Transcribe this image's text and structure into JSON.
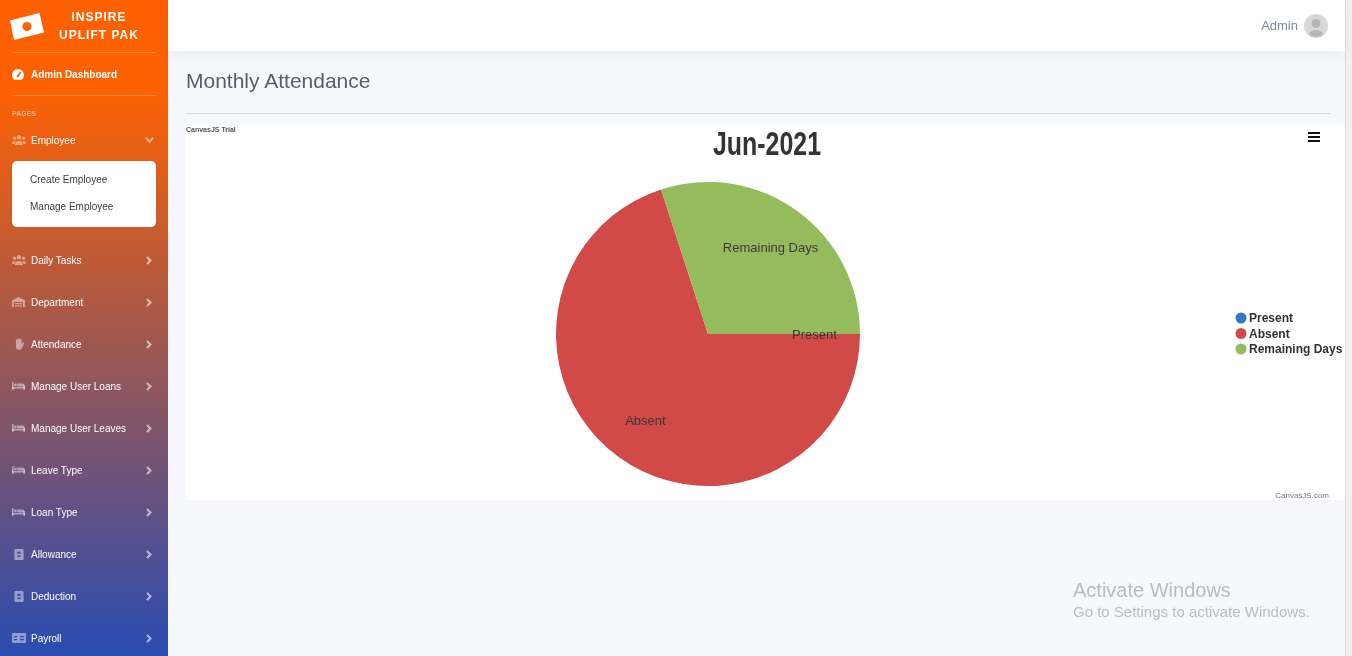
{
  "sidebar": {
    "brand": "INSPIRE UPLIFT PAK",
    "dashboard_link": "Admin Dashboard",
    "section_heading": "PAGES",
    "items": [
      {
        "label": "Employee",
        "expanded": true,
        "children": [
          {
            "label": "Create Employee"
          },
          {
            "label": "Manage Employee"
          }
        ]
      },
      {
        "label": "Daily Tasks",
        "expanded": false
      },
      {
        "label": "Department",
        "expanded": false
      },
      {
        "label": "Attendance",
        "expanded": false
      },
      {
        "label": "Manage User Loans",
        "expanded": false
      },
      {
        "label": "Manage User Leaves",
        "expanded": false
      },
      {
        "label": "Leave Type",
        "expanded": false
      },
      {
        "label": "Loan Type",
        "expanded": false
      },
      {
        "label": "Allowance",
        "expanded": false
      },
      {
        "label": "Deduction",
        "expanded": false
      },
      {
        "label": "Payroll",
        "expanded": false
      }
    ]
  },
  "topbar": {
    "user_name": "Admin"
  },
  "page": {
    "title": "Monthly Attendance"
  },
  "chart": {
    "trial_notice": "CanvasJS Trial",
    "credit": "CanvasJS.com",
    "chart_data": {
      "type": "pie",
      "title": "Jun-2021",
      "categories": [
        "Present",
        "Absent",
        "Remaining Days"
      ],
      "values": [
        0,
        70,
        30
      ]
    },
    "legend": [
      {
        "label": "Present",
        "color": "#3079c2"
      },
      {
        "label": "Absent",
        "color": "#d14a47"
      },
      {
        "label": "Remaining Days",
        "color": "#94bb5c"
      }
    ]
  },
  "windows_notice": {
    "title": "Activate Windows",
    "message": "Go to Settings to activate Windows."
  }
}
